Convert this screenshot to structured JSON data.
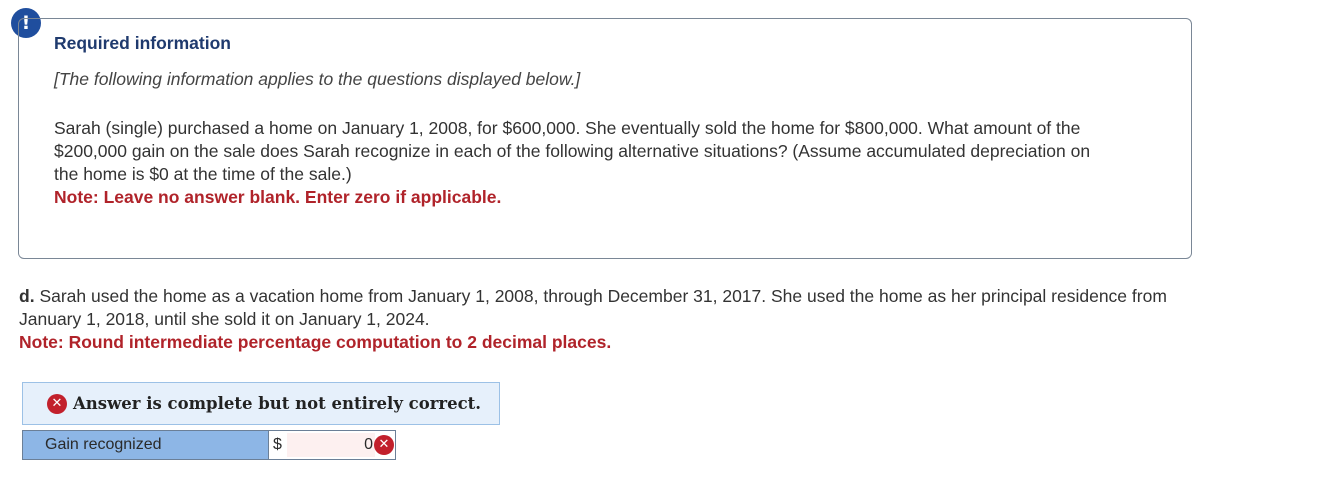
{
  "alert": {
    "icon": "exclamation-icon",
    "glyph": "!"
  },
  "info": {
    "title": "Required information",
    "intro": "[The following information applies to the questions displayed below.]",
    "body": "Sarah (single) purchased a home on January 1, 2008, for $600,000. She eventually sold the home for $800,000. What amount of the $200,000 gain on the sale does Sarah recognize in each of the following alternative situations? (Assume accumulated depreciation on the home is $0 at the time of the sale.)",
    "note": "Note: Leave no answer blank. Enter zero if applicable."
  },
  "question": {
    "letter": "d.",
    "text": "Sarah used the home as a vacation home from January 1, 2008, through December 31, 2017. She used the home as her principal residence from January 1, 2018, until she sold it on January 1, 2024.",
    "note": "Note: Round intermediate percentage computation to 2 decimal places."
  },
  "status": {
    "icon": "x-circle-icon",
    "glyph": "✕",
    "text": "Answer is complete but not entirely correct."
  },
  "answer": {
    "label": "Gain recognized",
    "currency": "$",
    "value": "0",
    "icon": "x-circle-icon",
    "glyph": "✕"
  },
  "colors": {
    "accent": "#1f4e9e",
    "note": "#b0232a",
    "error": "#c2202c",
    "label_bg": "#8db6e6",
    "status_bg": "#e6f0fb"
  }
}
